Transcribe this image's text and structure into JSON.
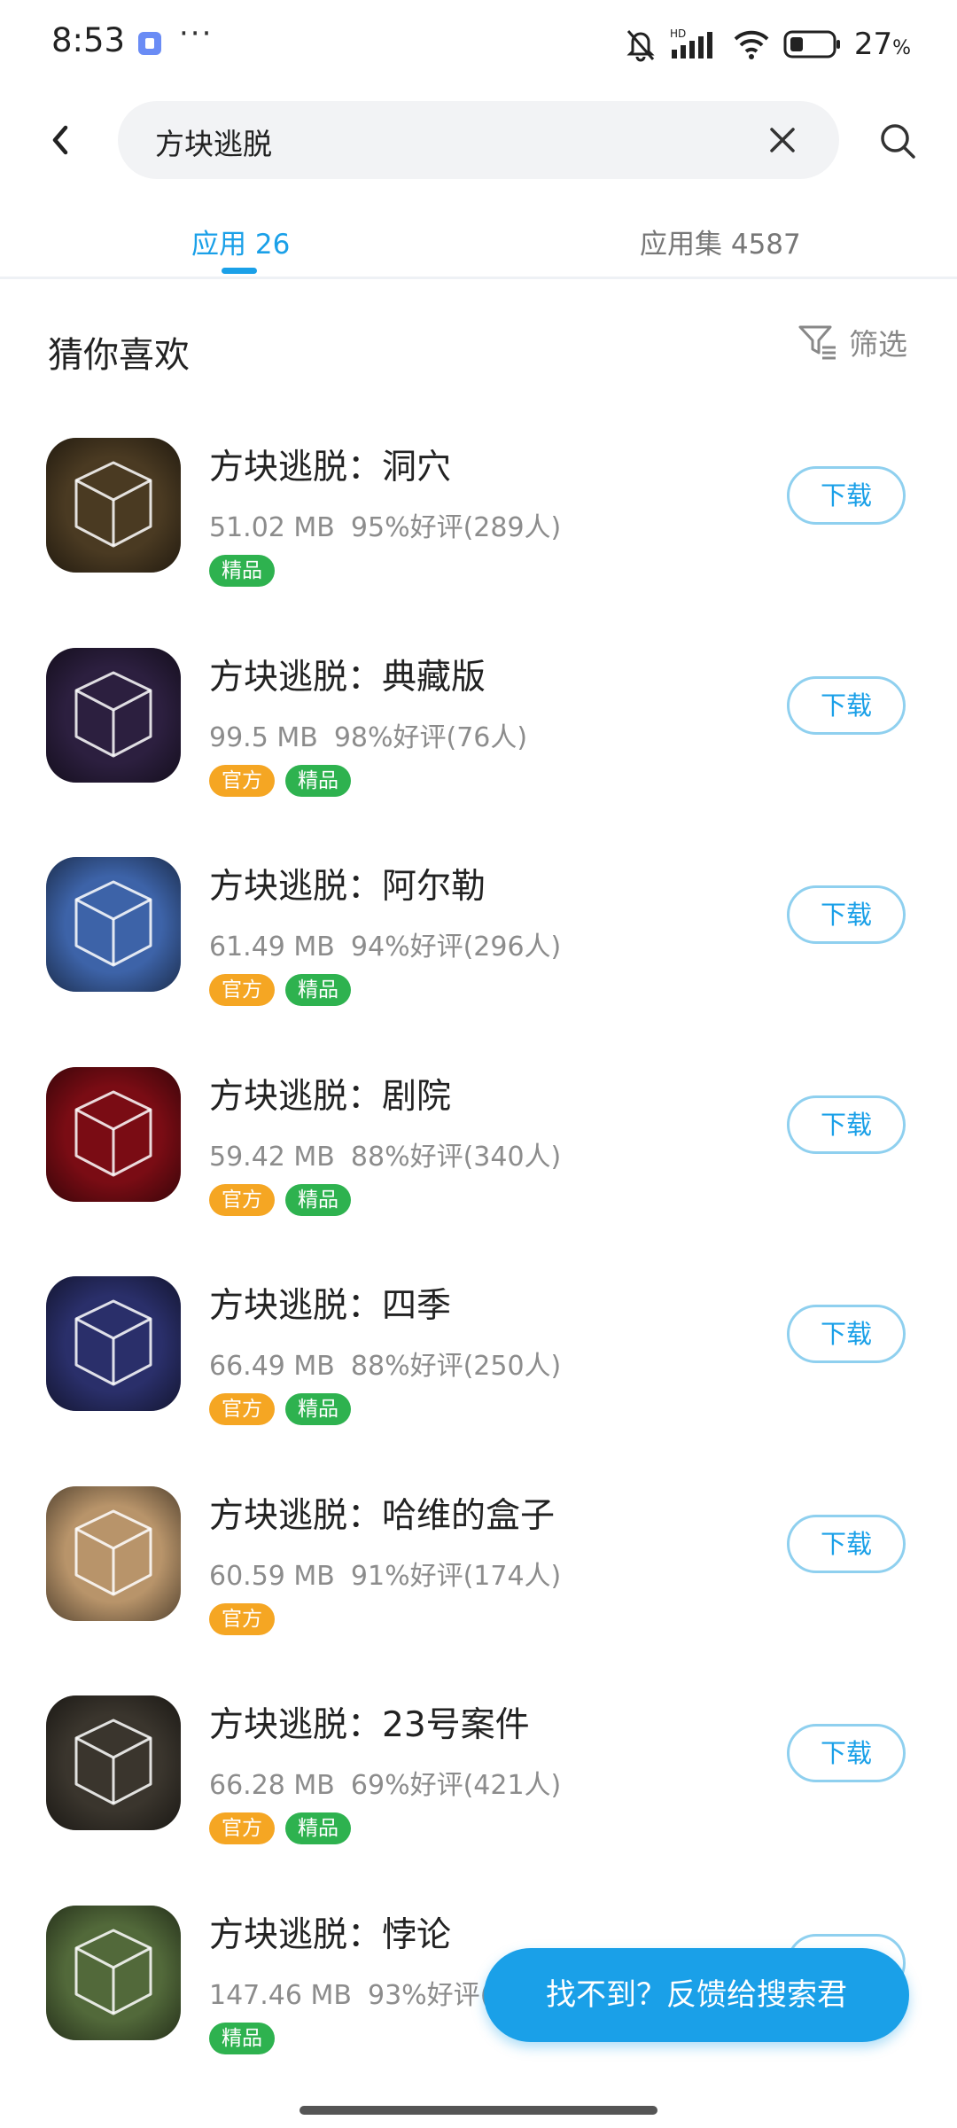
{
  "status_bar": {
    "time": "8:53",
    "overflow": "···",
    "battery_percent": "27",
    "battery_unit": "%",
    "hd_label": "HD"
  },
  "search": {
    "query": "方块逃脱"
  },
  "tabs": [
    {
      "label": "应用 26"
    },
    {
      "label": "应用集 4587"
    }
  ],
  "section": {
    "title": "猜你喜欢",
    "filter_label": "筛选"
  },
  "apps": [
    {
      "name": "方块逃脱：洞穴",
      "size": "51.02 MB",
      "rating": "95%好评(289人)",
      "badges": [
        "精品"
      ],
      "download": "下载",
      "icon_color": "#4a3a22"
    },
    {
      "name": "方块逃脱：典藏版",
      "size": "99.5 MB",
      "rating": "98%好评(76人)",
      "badges": [
        "官方",
        "精品"
      ],
      "download": "下载",
      "icon_color": "#2c1f3f"
    },
    {
      "name": "方块逃脱：阿尔勒",
      "size": "61.49 MB",
      "rating": "94%好评(296人)",
      "badges": [
        "官方",
        "精品"
      ],
      "download": "下载",
      "icon_color": "#3d63a8"
    },
    {
      "name": "方块逃脱：剧院",
      "size": "59.42 MB",
      "rating": "88%好评(340人)",
      "badges": [
        "官方",
        "精品"
      ],
      "download": "下载",
      "icon_color": "#7a0c14"
    },
    {
      "name": "方块逃脱：四季",
      "size": "66.49 MB",
      "rating": "88%好评(250人)",
      "badges": [
        "官方",
        "精品"
      ],
      "download": "下载",
      "icon_color": "#2a2f6a"
    },
    {
      "name": "方块逃脱：哈维的盒子",
      "size": "60.59 MB",
      "rating": "91%好评(174人)",
      "badges": [
        "官方"
      ],
      "download": "下载",
      "icon_color": "#b8946a"
    },
    {
      "name": "方块逃脱：23号案件",
      "size": "66.28 MB",
      "rating": "69%好评(421人)",
      "badges": [
        "官方",
        "精品"
      ],
      "download": "下载",
      "icon_color": "#3a352d"
    },
    {
      "name": "方块逃脱：悖论",
      "size": "147.46 MB",
      "rating": "93%好评(5",
      "badges": [
        "精品"
      ],
      "download": "下载",
      "icon_color": "#52693a"
    }
  ],
  "feedback": {
    "label": "找不到？反馈给搜索君"
  },
  "colors": {
    "accent": "#1aa0e8",
    "official_badge": "#f5a623",
    "quality_badge": "#2eb24f"
  }
}
